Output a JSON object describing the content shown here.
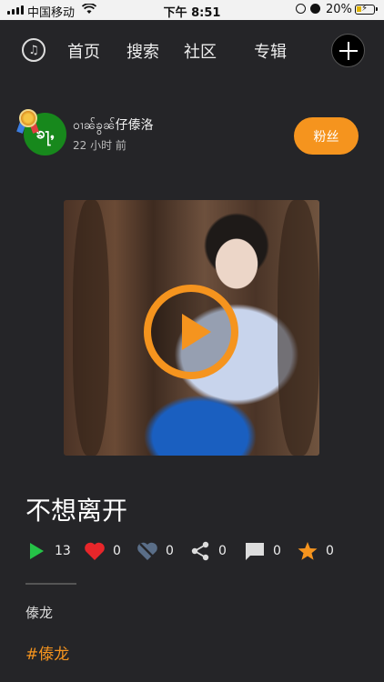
{
  "status_bar": {
    "carrier": "中国移动",
    "time": "下午 8:51",
    "battery": "20%"
  },
  "nav": {
    "tabs": [
      "首页",
      "搜索",
      "社区",
      "专辑"
    ],
    "logo_icon": "music-logo-icon",
    "add_icon": "plus-icon"
  },
  "post": {
    "author": "ဝၢၼ်ၶွၼ်仔傣洛",
    "time_ago": "22 小时 前",
    "avatar_text": "ၶႃႇ",
    "follow_label": "粉丝"
  },
  "song": {
    "title": "不想离开",
    "stats": {
      "plays": "13",
      "likes": "0",
      "dislikes": "0",
      "shares": "0",
      "comments": "0",
      "favorites": "0"
    },
    "category": "傣龙",
    "tag": "#傣龙"
  },
  "colors": {
    "accent": "#f5941e",
    "background": "#252528",
    "play_green": "#25c247",
    "heart_red": "#e8262a"
  }
}
